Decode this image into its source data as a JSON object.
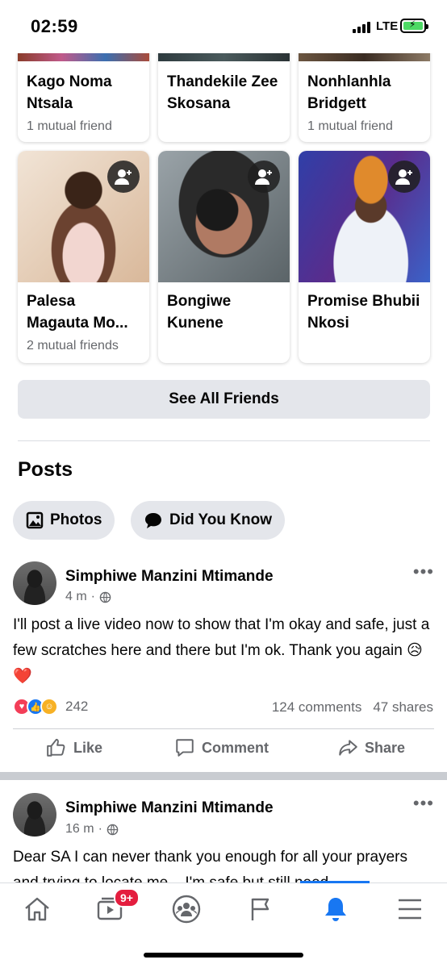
{
  "status_bar": {
    "time": "02:59",
    "network": "LTE"
  },
  "friends": [
    {
      "name": "Kago Noma Ntsala",
      "mutual": "1 mutual friend"
    },
    {
      "name": "Thandekile Zee Skosana",
      "mutual": ""
    },
    {
      "name": "Nonhlanhla Bridgett",
      "mutual": "1 mutual friend"
    },
    {
      "name": "Palesa Magauta Mo...",
      "mutual": "2 mutual friends"
    },
    {
      "name": "Bongiwe Kunene",
      "mutual": ""
    },
    {
      "name": "Promise Bhubii Nkosi",
      "mutual": ""
    }
  ],
  "see_all_label": "See All Friends",
  "posts_section": {
    "title": "Posts",
    "chips": [
      {
        "label": "Photos",
        "icon": "photos-icon"
      },
      {
        "label": "Did You Know",
        "icon": "speech-bubble-icon"
      }
    ]
  },
  "posts": [
    {
      "author": "Simphiwe Manzini Mtimande",
      "time": "4 m",
      "privacy_icon": "globe-icon",
      "text": "I'll post a live video now to show that I'm okay and safe, just a few scratches here and there but I'm ok. Thank you again 😥❤️",
      "reactions": [
        "love",
        "like",
        "care"
      ],
      "reaction_count": "242",
      "comments": "124 comments",
      "shares": "47 shares"
    },
    {
      "author": "Simphiwe Manzini Mtimande",
      "time": "16 m",
      "privacy_icon": "globe-icon",
      "text": "Dear SA I can never thank you enough for all your prayers and trying to locate me... I'm safe but still need"
    }
  ],
  "post_actions": {
    "like": "Like",
    "comment": "Comment",
    "share": "Share"
  },
  "bottom_nav": {
    "items": [
      "home-icon",
      "video-icon",
      "groups-icon",
      "pages-flag-icon",
      "notifications-bell-icon",
      "menu-icon"
    ],
    "active": "notifications-bell-icon",
    "video_badge": "9+"
  },
  "colors": {
    "accent": "#1877f2",
    "badge": "#e41e3f",
    "secondary_text": "#65676b",
    "button_bg": "#e4e6eb"
  }
}
